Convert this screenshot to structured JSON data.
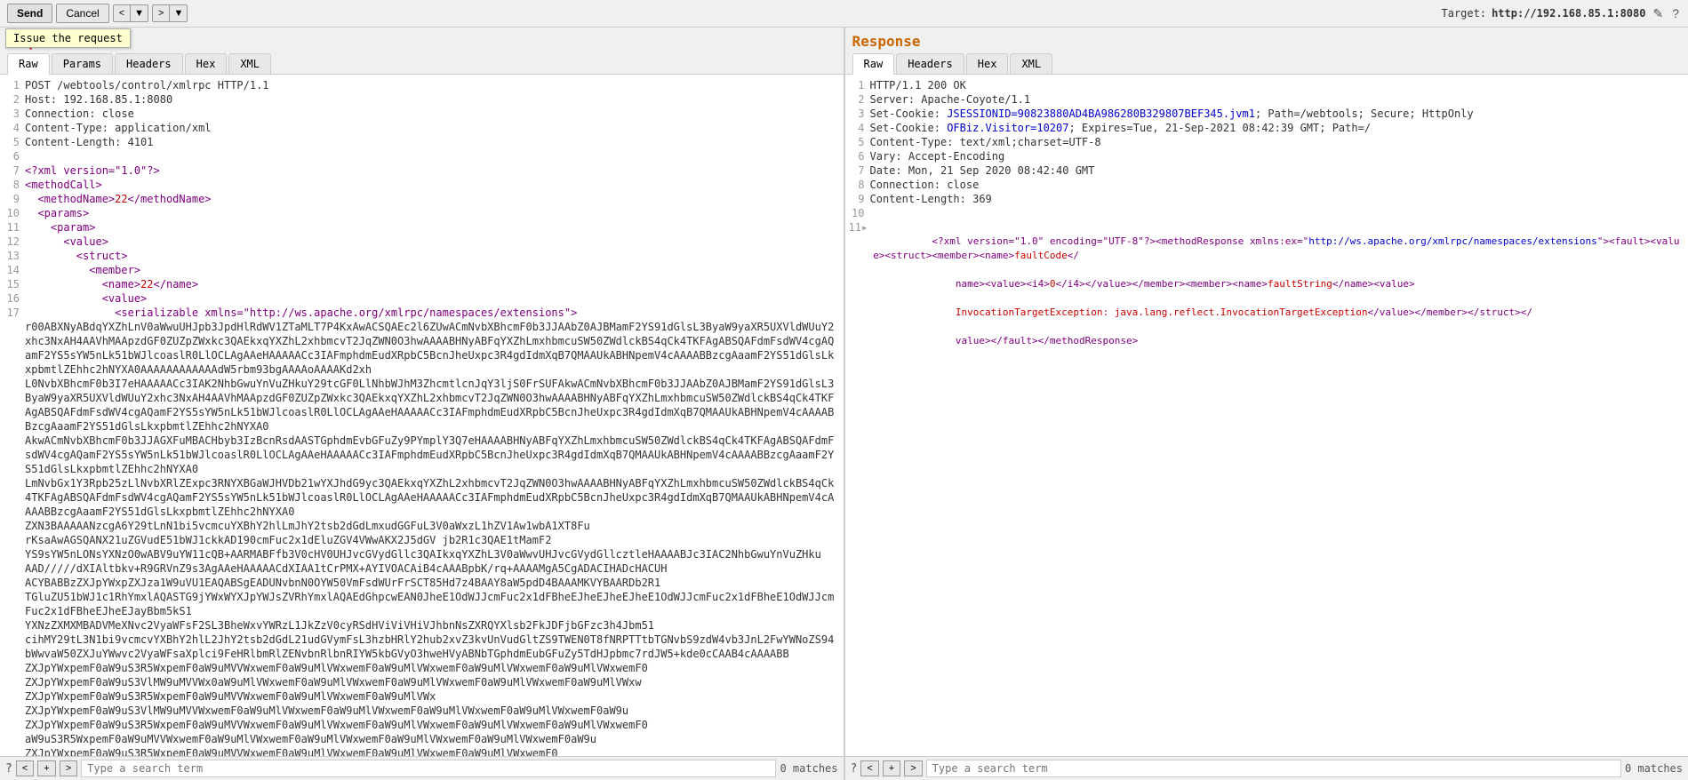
{
  "toolbar": {
    "send_label": "Send",
    "cancel_label": "Cancel",
    "tooltip_text": "Issue the request",
    "prev_label": "<",
    "prev_dropdown": "▼",
    "next_label": ">",
    "next_dropdown": "▼",
    "target_prefix": "Target:",
    "target_url": "http://192.168.85.1:8080",
    "edit_icon": "✎",
    "help_icon": "?"
  },
  "request": {
    "title": "Request",
    "tabs": [
      {
        "id": "raw",
        "label": "Raw",
        "active": true
      },
      {
        "id": "params",
        "label": "Params",
        "active": false
      },
      {
        "id": "headers",
        "label": "Headers",
        "active": false
      },
      {
        "id": "hex",
        "label": "Hex",
        "active": false
      },
      {
        "id": "xml",
        "label": "XML",
        "active": false
      }
    ],
    "search_placeholder": "Type a search term",
    "matches_label": "0 matches"
  },
  "response": {
    "title": "Response",
    "tabs": [
      {
        "id": "raw",
        "label": "Raw",
        "active": true
      },
      {
        "id": "headers",
        "label": "Headers",
        "active": false
      },
      {
        "id": "hex",
        "label": "Hex",
        "active": false
      },
      {
        "id": "xml",
        "label": "XML",
        "active": false
      }
    ],
    "search_placeholder": "Type a search term",
    "matches_label": "0 matches"
  }
}
